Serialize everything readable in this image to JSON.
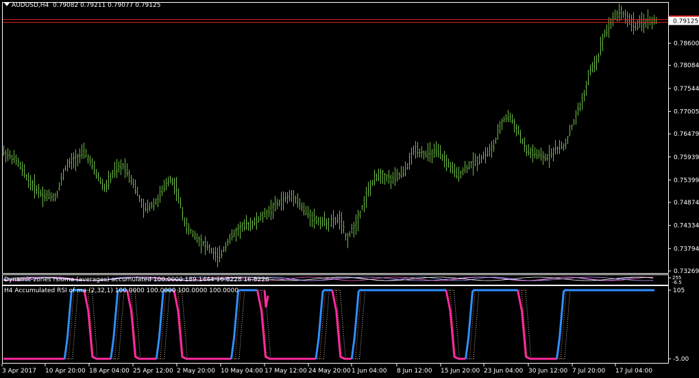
{
  "symbol_title": "AUDUSD,H4",
  "ohlc": "0.79082 0.79211 0.79077 0.79125",
  "current_price": "0.79125",
  "price_axis": [
    "0.78600",
    "0.78084",
    "0.77544",
    "0.77005",
    "0.76479",
    "0.75939",
    "0.75399",
    "0.74874",
    "0.74334",
    "0.73794",
    "0.73269"
  ],
  "indicator1_label": "Dynamic zones rsioma (averages) accumulated 100.0000 189.1444 16.8228 16.8228",
  "indicator1_axis": [
    "255",
    "-6.5"
  ],
  "indicator2_label": "H4 Accumulated RSI of ma (2,32,1) 100.0000 100.0000 100.0000 100.0000",
  "indicator2_axis": [
    "105",
    "-5.00"
  ],
  "time_axis": [
    "3 Apr 2017",
    "10 Apr 20:00",
    "18 Apr 04:00",
    "25 Apr 12:00",
    "2 May 20:00",
    "10 May 04:00",
    "17 May 12:00",
    "24 May 20:00",
    "1 Jun 04:00",
    "8 Jun 12:00",
    "15 Jun 20:00",
    "23 Jun 04:00",
    "30 Jun 12:00",
    "7 Jul 20:00",
    "17 Jul 04:00"
  ],
  "colors": {
    "candle": "#6fbf45",
    "price_line": "#d82020",
    "rsi_up": "#2f8fff",
    "rsi_down": "#ff2aa0",
    "axis": "#ffffff"
  },
  "rsi_segments": [
    {
      "state": "low",
      "from": 0,
      "to": 0.094
    },
    {
      "state": "up",
      "from": 0.094,
      "to": 0.124
    },
    {
      "state": "down",
      "from": 0.124,
      "to": 0.165
    },
    {
      "state": "up",
      "from": 0.165,
      "to": 0.19
    },
    {
      "state": "down",
      "from": 0.19,
      "to": 0.235
    },
    {
      "state": "up",
      "from": 0.235,
      "to": 0.262
    },
    {
      "state": "down",
      "from": 0.262,
      "to": 0.35
    },
    {
      "state": "up",
      "from": 0.35,
      "to": 0.39
    },
    {
      "state": "down",
      "from": 0.39,
      "to": 0.48
    },
    {
      "state": "up",
      "from": 0.48,
      "to": 0.505
    },
    {
      "state": "down",
      "from": 0.505,
      "to": 0.535
    },
    {
      "state": "up",
      "from": 0.535,
      "to": 0.68
    },
    {
      "state": "down",
      "from": 0.68,
      "to": 0.71
    },
    {
      "state": "up",
      "from": 0.71,
      "to": 0.79
    },
    {
      "state": "down",
      "from": 0.79,
      "to": 0.85
    },
    {
      "state": "up",
      "from": 0.85,
      "to": 1.0
    }
  ],
  "price_path": [
    [
      0,
      0.7605
    ],
    [
      0.02,
      0.7585
    ],
    [
      0.04,
      0.7535
    ],
    [
      0.06,
      0.7505
    ],
    [
      0.08,
      0.75
    ],
    [
      0.095,
      0.757
    ],
    [
      0.11,
      0.759
    ],
    [
      0.125,
      0.7605
    ],
    [
      0.14,
      0.756
    ],
    [
      0.155,
      0.752
    ],
    [
      0.17,
      0.756
    ],
    [
      0.185,
      0.7575
    ],
    [
      0.2,
      0.753
    ],
    [
      0.215,
      0.747
    ],
    [
      0.235,
      0.749
    ],
    [
      0.255,
      0.7545
    ],
    [
      0.265,
      0.752
    ],
    [
      0.28,
      0.743
    ],
    [
      0.3,
      0.74
    ],
    [
      0.315,
      0.738
    ],
    [
      0.33,
      0.7355
    ],
    [
      0.345,
      0.74
    ],
    [
      0.365,
      0.743
    ],
    [
      0.385,
      0.744
    ],
    [
      0.41,
      0.747
    ],
    [
      0.43,
      0.7495
    ],
    [
      0.445,
      0.7505
    ],
    [
      0.46,
      0.747
    ],
    [
      0.48,
      0.7445
    ],
    [
      0.5,
      0.744
    ],
    [
      0.515,
      0.745
    ],
    [
      0.525,
      0.74
    ],
    [
      0.54,
      0.744
    ],
    [
      0.56,
      0.752
    ],
    [
      0.575,
      0.7555
    ],
    [
      0.595,
      0.754
    ],
    [
      0.615,
      0.756
    ],
    [
      0.63,
      0.7615
    ],
    [
      0.645,
      0.76
    ],
    [
      0.665,
      0.7605
    ],
    [
      0.68,
      0.758
    ],
    [
      0.695,
      0.755
    ],
    [
      0.71,
      0.757
    ],
    [
      0.73,
      0.759
    ],
    [
      0.75,
      0.7615
    ],
    [
      0.765,
      0.768
    ],
    [
      0.775,
      0.769
    ],
    [
      0.79,
      0.765
    ],
    [
      0.8,
      0.761
    ],
    [
      0.815,
      0.76
    ],
    [
      0.83,
      0.759
    ],
    [
      0.845,
      0.761
    ],
    [
      0.86,
      0.762
    ],
    [
      0.875,
      0.768
    ],
    [
      0.89,
      0.774
    ],
    [
      0.9,
      0.78
    ],
    [
      0.91,
      0.782
    ],
    [
      0.92,
      0.788
    ],
    [
      0.935,
      0.792
    ],
    [
      0.945,
      0.7935
    ],
    [
      0.955,
      0.792
    ],
    [
      0.97,
      0.79
    ],
    [
      0.985,
      0.7912
    ],
    [
      1.0,
      0.7912
    ]
  ]
}
